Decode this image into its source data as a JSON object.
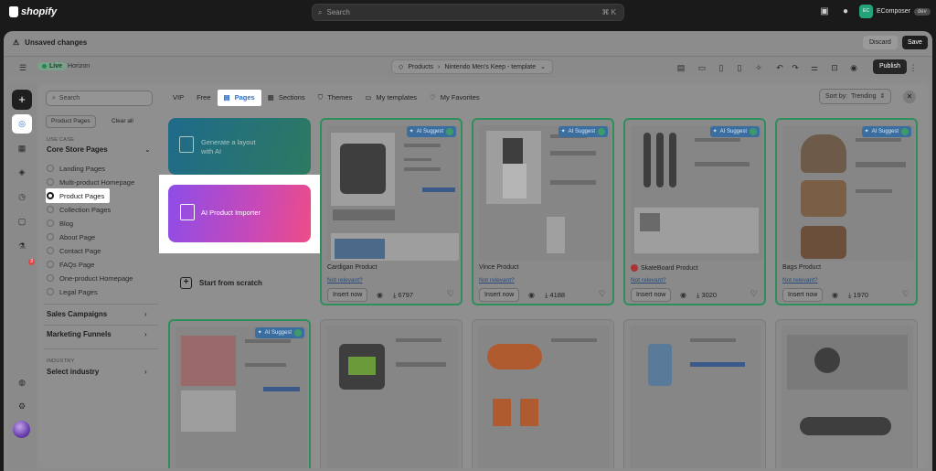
{
  "topbar": {
    "brand": "shopify",
    "search_placeholder": "Search",
    "shortcut": "⌘ K",
    "store_initials": "EC",
    "store_name": "EComposer",
    "store_tag": "dev"
  },
  "editor_bar": {
    "status": "Unsaved changes",
    "discard": "Discard",
    "save": "Save"
  },
  "toolbar": {
    "live": "Live",
    "theme": "Horizon",
    "crumb_section": "Products",
    "crumb_page": "Nintendo Men's Keep - template",
    "publish": "Publish"
  },
  "rail": {
    "notification_count": "3"
  },
  "modal": {
    "search_placeholder": "Search",
    "filter_chip": "Product Pages",
    "clear_all": "Clear all",
    "use_case_label": "USE CASE",
    "use_case_title": "Core Store Pages",
    "page_types": [
      "Landing Pages",
      "Multi-product Homepage",
      "Product Pages",
      "Collection Pages",
      "Blog",
      "About Page",
      "Contact Page",
      "FAQs Page",
      "One-product Homepage",
      "Legal Pages"
    ],
    "selected_index": 2,
    "sales_campaigns": "Sales Campaigns",
    "marketing_funnels": "Marketing Funnels",
    "industry_label": "INDUSTRY",
    "industry_select": "Select industry",
    "tabs": [
      "VIP",
      "Free",
      "Pages",
      "Sections",
      "Themes",
      "My templates",
      "My Favorites"
    ],
    "active_tab": "Pages",
    "sort_label": "Sort by:",
    "sort_value": "Trending",
    "generate": "Generate a layout with AI",
    "importer": "AI Product Importer",
    "scratch": "Start from scratch",
    "ai_badge": "AI Suggest",
    "not_relevant": "Not relevant?",
    "insert": "Insert now",
    "cards": [
      {
        "name": "Cardigan Product",
        "downloads": "6797",
        "ai": true
      },
      {
        "name": "Vince Product",
        "downloads": "4188",
        "ai": true
      },
      {
        "name": "SkateBoard Product",
        "downloads": "3020",
        "ai": true
      },
      {
        "name": "Bags Product",
        "downloads": "1970",
        "ai": true
      }
    ]
  },
  "colors": {
    "accent": "#2c6ecb",
    "ai_border": "#2f8f5c",
    "overlay": "#8f8f8f"
  }
}
